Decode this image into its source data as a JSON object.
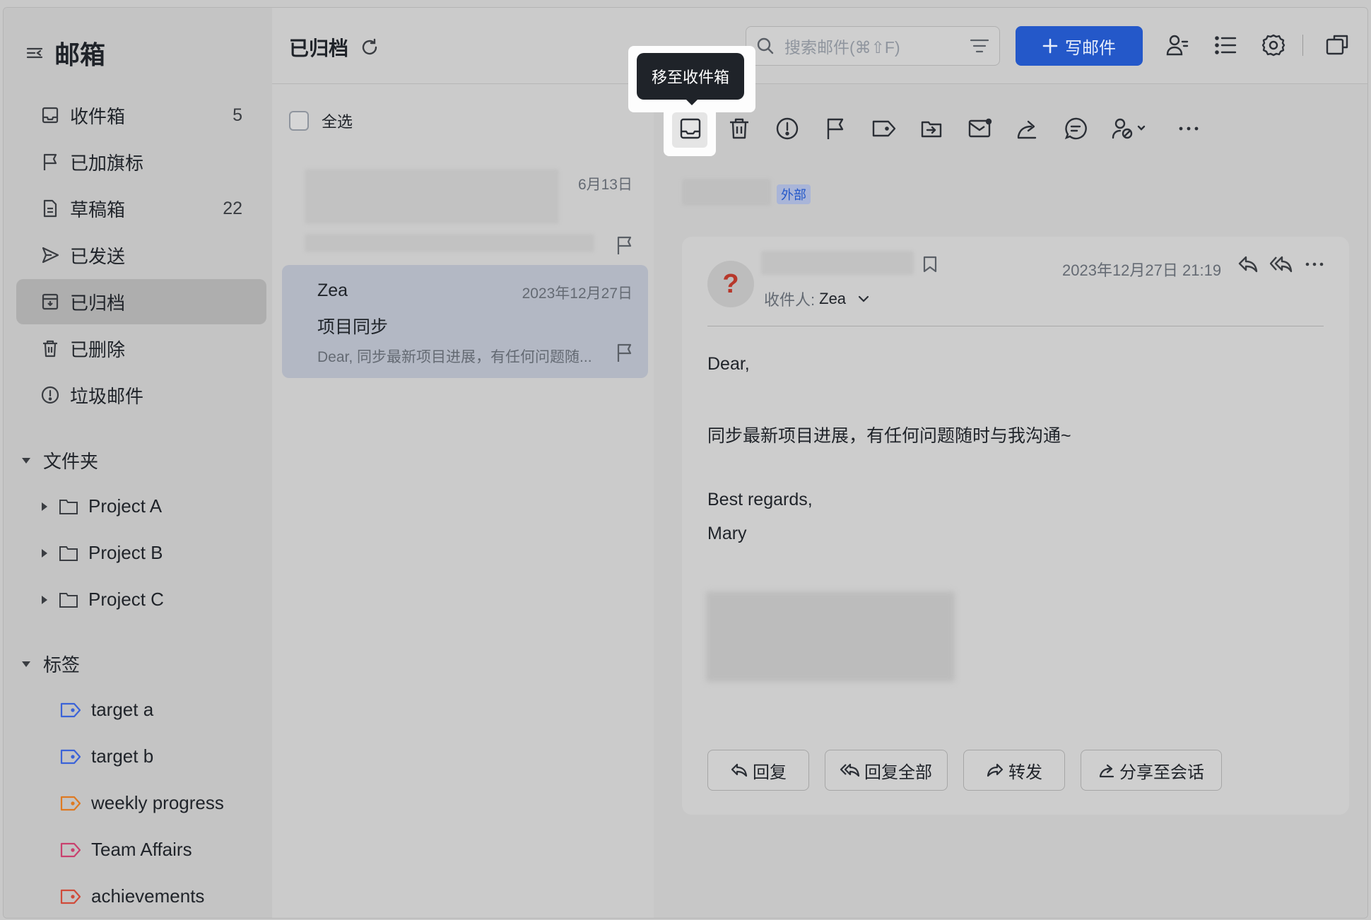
{
  "app": {
    "title": "邮箱"
  },
  "sidebar": {
    "items": [
      {
        "label": "收件箱",
        "count": "5",
        "icon": "inbox-icon"
      },
      {
        "label": "已加旗标",
        "count": "",
        "icon": "flag-icon"
      },
      {
        "label": "草稿箱",
        "count": "22",
        "icon": "draft-icon"
      },
      {
        "label": "已发送",
        "count": "",
        "icon": "send-icon"
      },
      {
        "label": "已归档",
        "count": "",
        "icon": "archive-icon",
        "active": true
      },
      {
        "label": "已删除",
        "count": "",
        "icon": "trash-icon"
      },
      {
        "label": "垃圾邮件",
        "count": "",
        "icon": "spam-icon"
      }
    ],
    "folders_title": "文件夹",
    "folders": [
      "Project A",
      "Project B",
      "Project C"
    ],
    "tags_title": "标签",
    "tags": [
      {
        "label": "target a",
        "color": "#3b63d8"
      },
      {
        "label": "target b",
        "color": "#3b63d8"
      },
      {
        "label": "weekly progress",
        "color": "#de7a22"
      },
      {
        "label": "Team Affairs",
        "color": "#c9406e"
      },
      {
        "label": "achievements",
        "color": "#d04b3a"
      }
    ]
  },
  "list": {
    "title": "已归档",
    "select_all": "全选",
    "rows": [
      {
        "sender": "",
        "subject": "",
        "preview": "",
        "date": "6月13日"
      },
      {
        "sender": "Zea",
        "subject": "项目同步",
        "preview": "Dear, 同步最新项目进展，有任何问题随...",
        "date": "2023年12月27日",
        "selected": true
      }
    ]
  },
  "header": {
    "search_placeholder": "搜索邮件(⌘⇧F)",
    "compose_label": "写邮件",
    "accent_color": "#2458c9"
  },
  "toolbar": {
    "tooltip": "移至收件箱",
    "icons": [
      "move-to-inbox-icon",
      "delete-icon",
      "spam-icon",
      "flag-icon",
      "label-icon",
      "move-icon",
      "mark-unread-icon",
      "share-icon",
      "comment-icon",
      "assign-icon",
      "more-icon"
    ]
  },
  "message": {
    "external_tag": "外部",
    "avatar_char": "?",
    "recipient_label": "收件人:",
    "recipient": "Zea",
    "time": "2023年12月27日 21:19",
    "body": {
      "greeting": "Dear,",
      "line1": "同步最新项目进展，有任何问题随时与我沟通~",
      "closing": "Best regards,",
      "signature": "Mary"
    },
    "actions": {
      "reply": "回复",
      "reply_all": "回复全部",
      "forward": "转发",
      "share": "分享至会话"
    }
  }
}
